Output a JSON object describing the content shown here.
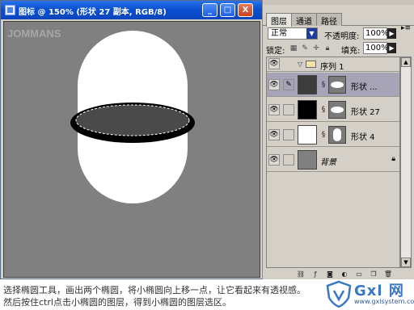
{
  "document": {
    "title": "图标 @ 150% (形状 27 副本, RGB/8)",
    "watermark": "JOMMANS",
    "buttons": {
      "minimize": "_",
      "restore": "□",
      "close": "X"
    }
  },
  "layers_panel": {
    "tabs": [
      "图层",
      "通道",
      "路径"
    ],
    "active_tab": "图层",
    "blend_mode": "正常",
    "opacity_label": "不透明度:",
    "opacity_value": "100%",
    "lock_label": "锁定:",
    "fill_label": "填充:",
    "fill_value": "100%",
    "layers": [
      {
        "name": "序列 1",
        "type": "group",
        "selected": false
      },
      {
        "name": "形状 ...",
        "type": "shape",
        "selected": true
      },
      {
        "name": "形状 27",
        "type": "shape",
        "selected": false
      },
      {
        "name": "形状 4",
        "type": "shape",
        "selected": false
      },
      {
        "name": "背景",
        "type": "background",
        "selected": false
      }
    ]
  },
  "caption": {
    "line1": "选择椭圆工具，画出两个椭圆，将小椭圆向上移一点，让它看起来有透视感。",
    "line2": "然后按住ctrl点击小椭圆的图层，得到小椭圆的图层选区。"
  },
  "logo": {
    "text": "Gxl 网",
    "domain": "www.gxlsystem.com",
    "color": "#3a78c2"
  },
  "colors": {
    "titlebar": "#0b4fd2",
    "canvas_bg": "#808080",
    "selected_layer": "#a6a4b6"
  }
}
